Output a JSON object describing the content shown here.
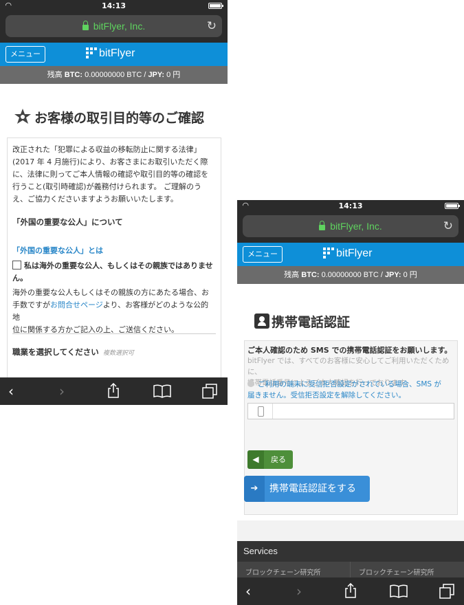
{
  "phone1": {
    "status_time": "14:13",
    "url": "bitFlyer, Inc.",
    "menu_label": "メニュー",
    "logo_text": "bitFlyer",
    "balance_prefix": "残高 ",
    "balance_btc_label": "BTC:",
    "balance_btc_value": " 0.00000000 BTC / ",
    "balance_jpy_label": "JPY:",
    "balance_jpy_value": " 0 円",
    "page_title": "お客様の取引目的等のご確認",
    "intro_lines": [
      "改正された「犯罪による収益の移転防止に関する法律」",
      "(2017 年 4 月施行)により、お客さまにお取引いただく際",
      "に、法律に則ってご本人情報の確認や取引目的等の確認を",
      "行うこと(取引時確認)が義務付けられます。 ご理解のう",
      "え、ご協力くださいますようお願いいたします。"
    ],
    "section_heading": "「外国の重要な公人」について",
    "pep_link": "「外国の重要な公人」とは",
    "pep_checkbox_line1": "私は海外の重要な公人、もしくはその親族ではありませ",
    "pep_checkbox_line2": "ん。",
    "pep_note_line1": "海外の重要な公人もしくはその親族の方にあたる場合、お",
    "pep_note_line2_a": "手数ですが",
    "pep_note_line2_link": "お問合せページ",
    "pep_note_line2_b": "より、お客様がどのような公的地",
    "pep_note_line3": "位に関係する方かご記入の上、ご送信ください。",
    "occupation_label": "職業を選択してください",
    "occupation_note": "複数選択可"
  },
  "phone2": {
    "status_time": "14:13",
    "url": "bitFlyer, Inc.",
    "menu_label": "メニュー",
    "logo_text": "bitFlyer",
    "balance_prefix": "残高 ",
    "balance_btc_label": "BTC:",
    "balance_btc_value": " 0.00000000 BTC / ",
    "balance_jpy_label": "JPY:",
    "balance_jpy_value": " 0 円",
    "page_title": "携帯電話認証",
    "heading": "ご本人確認のため SMS での携帯電話認証をお願いします。",
    "desc_line1": "bitFlyer では、すべてのお客様に安心してご利用いただくために、",
    "desc_line2": "携帯電話番号によるご本人確認を行っております。",
    "info_line1": "ご利用の端末に受信拒否設定がされている場合、SMS が",
    "info_line2": "届きません。受信拒否設定を解除してください。",
    "phone_value": "",
    "back_label": "戻る",
    "submit_label": "携帯電話認証をする",
    "services_label": "Services",
    "services_items": [
      "ブロックチェーン研究所",
      "ブロックチェーン研究所"
    ]
  },
  "colors": {
    "brand_blue": "#0e8fd8",
    "url_green": "#5fd35f",
    "link_blue": "#2a87c8",
    "back_green": "#4e8f3a",
    "submit_blue": "#3a8fd8"
  },
  "icons": {
    "back": "chevron-left-icon",
    "forward": "chevron-right-icon",
    "share": "share-icon",
    "bookmarks": "book-icon",
    "tabs": "tabs-icon"
  }
}
